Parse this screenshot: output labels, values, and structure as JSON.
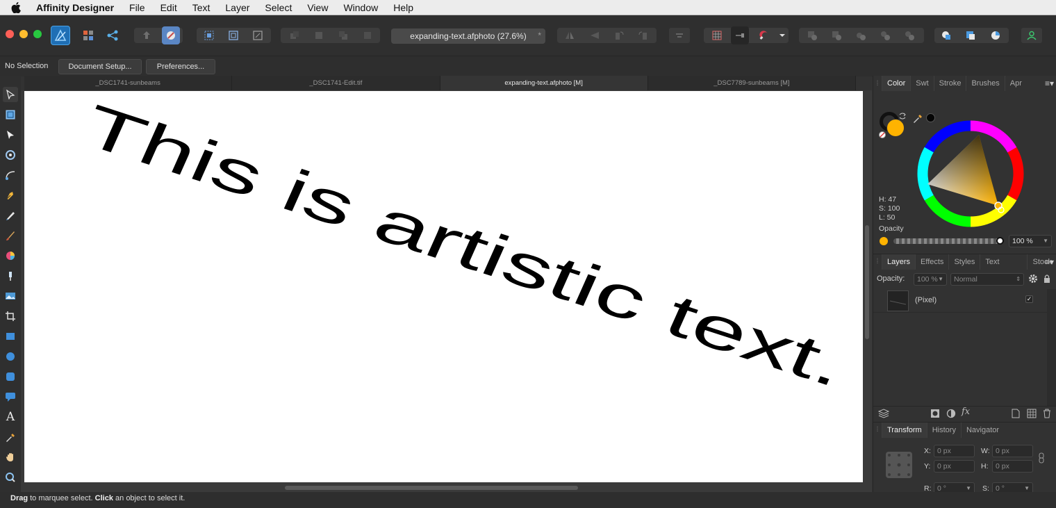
{
  "menubar": {
    "app_name": "Affinity Designer",
    "items": [
      "File",
      "Edit",
      "Text",
      "Layer",
      "Select",
      "View",
      "Window",
      "Help"
    ]
  },
  "toolbar": {
    "document_title": "expanding-text.afphoto (27.6%)",
    "modified_indicator": "*"
  },
  "context": {
    "selection_status": "No Selection",
    "document_setup_label": "Document Setup...",
    "preferences_label": "Preferences..."
  },
  "doc_tabs": [
    {
      "label": "_DSC1741-sunbeams",
      "active": false
    },
    {
      "label": "_DSC1741-Edit.tif",
      "active": false
    },
    {
      "label": "expanding-text.afphoto [M]",
      "active": true
    },
    {
      "label": "_DSC7789-sunbeams [M]",
      "active": false
    }
  ],
  "canvas": {
    "artistic_text": "This is artistic text."
  },
  "color_panel": {
    "tabs": [
      "Color",
      "Swt",
      "Stroke",
      "Brushes",
      "Apr"
    ],
    "active_tab": "Color",
    "h": "H: 47",
    "s": "S: 100",
    "l": "L: 50",
    "opacity_label": "Opacity",
    "opacity_value": "100 %",
    "fill_color": "#ffb300"
  },
  "layers_panel": {
    "tabs": [
      "Layers",
      "Effects",
      "Styles",
      "Text Styles",
      "Stock"
    ],
    "active_tab": "Layers",
    "opacity_label": "Opacity:",
    "opacity_value": "100 %",
    "blend_mode": "Normal",
    "layers": [
      {
        "name": "(Pixel)",
        "visible": true
      }
    ]
  },
  "transform_panel": {
    "tabs": [
      "Transform",
      "History",
      "Navigator"
    ],
    "active_tab": "Transform",
    "x_label": "X:",
    "x_value": "0 px",
    "y_label": "Y:",
    "y_value": "0 px",
    "w_label": "W:",
    "w_value": "0 px",
    "h_label": "H:",
    "h_value": "0 px",
    "r_label": "R:",
    "r_value": "0 °",
    "s_label": "S:",
    "s_value": "0 °"
  },
  "statusbar": {
    "drag_word": "Drag",
    "drag_rest": " to marquee select. ",
    "click_word": "Click",
    "click_rest": " an object to select it."
  }
}
